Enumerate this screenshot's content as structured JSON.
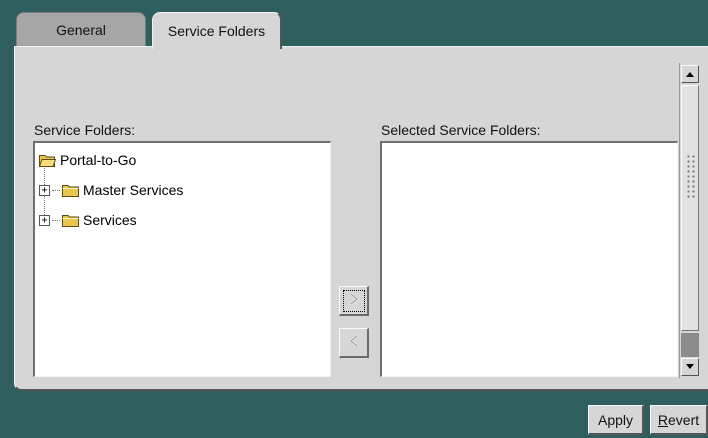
{
  "tabs": [
    {
      "label": "General",
      "selected": false
    },
    {
      "label": "Service Folders",
      "selected": true
    }
  ],
  "left_list": {
    "label": "Service Folders:",
    "tree": {
      "root": {
        "label": "Portal-to-Go",
        "icon": "open-folder-icon"
      },
      "children": [
        {
          "label": "Master Services",
          "icon": "folder-icon",
          "expandable": true
        },
        {
          "label": "Services",
          "icon": "folder-icon",
          "expandable": true
        }
      ]
    }
  },
  "right_list": {
    "label": "Selected Service Folders:",
    "items": []
  },
  "move_buttons": {
    "add_icon": "chevron-right-icon",
    "remove_icon": "chevron-left-icon",
    "remove_enabled": false
  },
  "buttons": {
    "apply": "Apply",
    "revert_first": "R",
    "revert_rest": "evert"
  },
  "colors": {
    "background": "#2f5e5e",
    "panel": "#d6d6d6",
    "list_bg": "#ffffff",
    "folder": "#e8c74a"
  }
}
